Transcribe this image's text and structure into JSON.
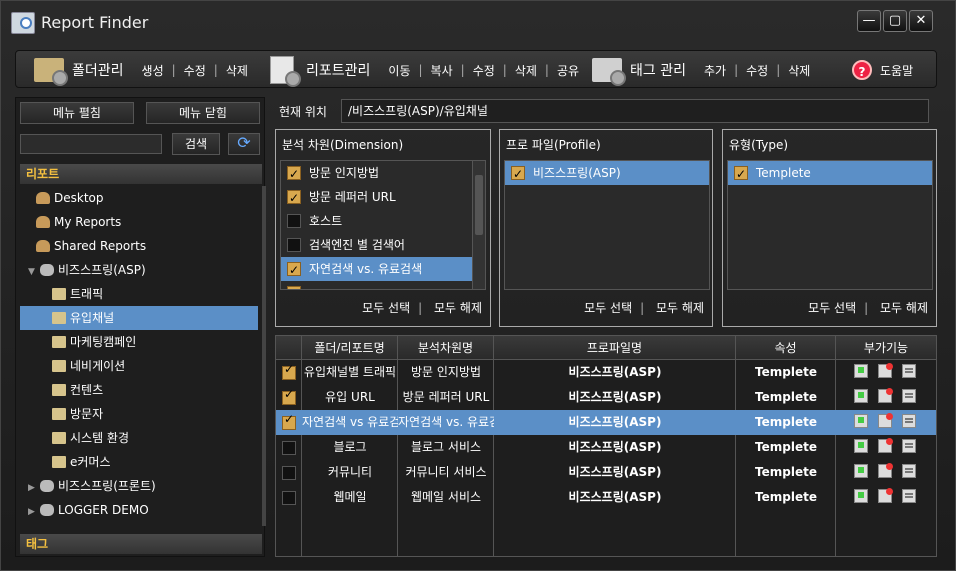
{
  "window": {
    "title": "Report Finder",
    "btn_min": "—",
    "btn_max": "▢",
    "btn_close": "✕"
  },
  "toolbar": {
    "folder": {
      "label": "폴더관리",
      "actions": [
        "생성",
        "수정",
        "삭제"
      ]
    },
    "report": {
      "label": "리포트관리",
      "actions": [
        "이동",
        "복사",
        "수정",
        "삭제",
        "공유"
      ]
    },
    "tag": {
      "label": "태그 관리",
      "actions": [
        "추가",
        "수정",
        "삭제"
      ]
    },
    "help": "도움말"
  },
  "left": {
    "expand_all": "메뉴 펼침",
    "collapse_all": "메뉴 닫힘",
    "search_value": "",
    "search_button": "검색",
    "report_section": "리포트",
    "tag_section": "태그",
    "tree": [
      {
        "label": "Desktop",
        "icon": "user-icon",
        "level": 1
      },
      {
        "label": "My Reports",
        "icon": "user-icon",
        "level": 1
      },
      {
        "label": "Shared Reports",
        "icon": "users-icon",
        "level": 1
      },
      {
        "label": "비즈스프링(ASP)",
        "icon": "database-icon",
        "level": 0,
        "expanded": true
      },
      {
        "label": "트래픽",
        "icon": "folder-icon",
        "level": 2
      },
      {
        "label": "유입채널",
        "icon": "folder-icon",
        "level": 2,
        "selected": true
      },
      {
        "label": "마케팅캠페인",
        "icon": "folder-icon",
        "level": 2
      },
      {
        "label": "네비게이션",
        "icon": "folder-icon",
        "level": 2
      },
      {
        "label": "컨텐츠",
        "icon": "folder-icon",
        "level": 2
      },
      {
        "label": "방문자",
        "icon": "folder-icon",
        "level": 2
      },
      {
        "label": "시스템 환경",
        "icon": "folder-icon",
        "level": 2
      },
      {
        "label": "e커머스",
        "icon": "folder-icon",
        "level": 2
      },
      {
        "label": "비즈스프링(프론트)",
        "icon": "database-icon",
        "level": 0,
        "expanded": false
      },
      {
        "label": "LOGGER DEMO",
        "icon": "database-icon",
        "level": 0,
        "expanded": false
      }
    ]
  },
  "location": {
    "label": "현재 위치",
    "value": "/비즈스프링(ASP)/유입채널"
  },
  "dimension_panel": {
    "title": "분석 차원(Dimension)",
    "items": [
      {
        "label": "방문 인지방법",
        "checked": true
      },
      {
        "label": "방문 레퍼러 URL",
        "checked": true
      },
      {
        "label": "호스트",
        "checked": false
      },
      {
        "label": "검색엔진 별 검색어",
        "checked": false
      },
      {
        "label": "자연검색 vs. 유료검색",
        "checked": true,
        "selected": true
      },
      {
        "label": "",
        "checked": true
      }
    ],
    "select_all": "모두 선택",
    "clear_all": "모두 해제"
  },
  "profile_panel": {
    "title": "프로 파일(Profile)",
    "items": [
      {
        "label": "비즈스프링(ASP)",
        "checked": true,
        "selected": true
      }
    ],
    "select_all": "모두 선택",
    "clear_all": "모두 해제"
  },
  "type_panel": {
    "title": "유형(Type)",
    "items": [
      {
        "label": "Templete",
        "checked": true,
        "selected": true
      }
    ],
    "select_all": "모두 선택",
    "clear_all": "모두 해제"
  },
  "grid": {
    "headers": [
      "폴더/리포트명",
      "분석차원명",
      "프로파일명",
      "속성",
      "부가기능"
    ],
    "rows": [
      {
        "checked": true,
        "name": "유입채널별 트래픽",
        "dimension": "방문 인지방법",
        "profile": "비즈스프링(ASP)",
        "attr": "Templete",
        "selected": false
      },
      {
        "checked": true,
        "name": "유입 URL",
        "dimension": "방문 레퍼러 URL",
        "profile": "비즈스프링(ASP)",
        "attr": "Templete",
        "selected": false
      },
      {
        "checked": true,
        "name": "자연검색 vs 유료검색",
        "dimension": "자연검색 vs. 유료검색",
        "profile": "비즈스프링(ASP)",
        "attr": "Templete",
        "selected": true
      },
      {
        "checked": false,
        "name": "블로그",
        "dimension": "블로그 서비스",
        "profile": "비즈스프링(ASP)",
        "attr": "Templete",
        "selected": false
      },
      {
        "checked": false,
        "name": "커뮤니티",
        "dimension": "커뮤니티 서비스",
        "profile": "비즈스프링(ASP)",
        "attr": "Templete",
        "selected": false
      },
      {
        "checked": false,
        "name": "웹메일",
        "dimension": "웹메일 서비스",
        "profile": "비즈스프링(ASP)",
        "attr": "Templete",
        "selected": false
      }
    ]
  }
}
